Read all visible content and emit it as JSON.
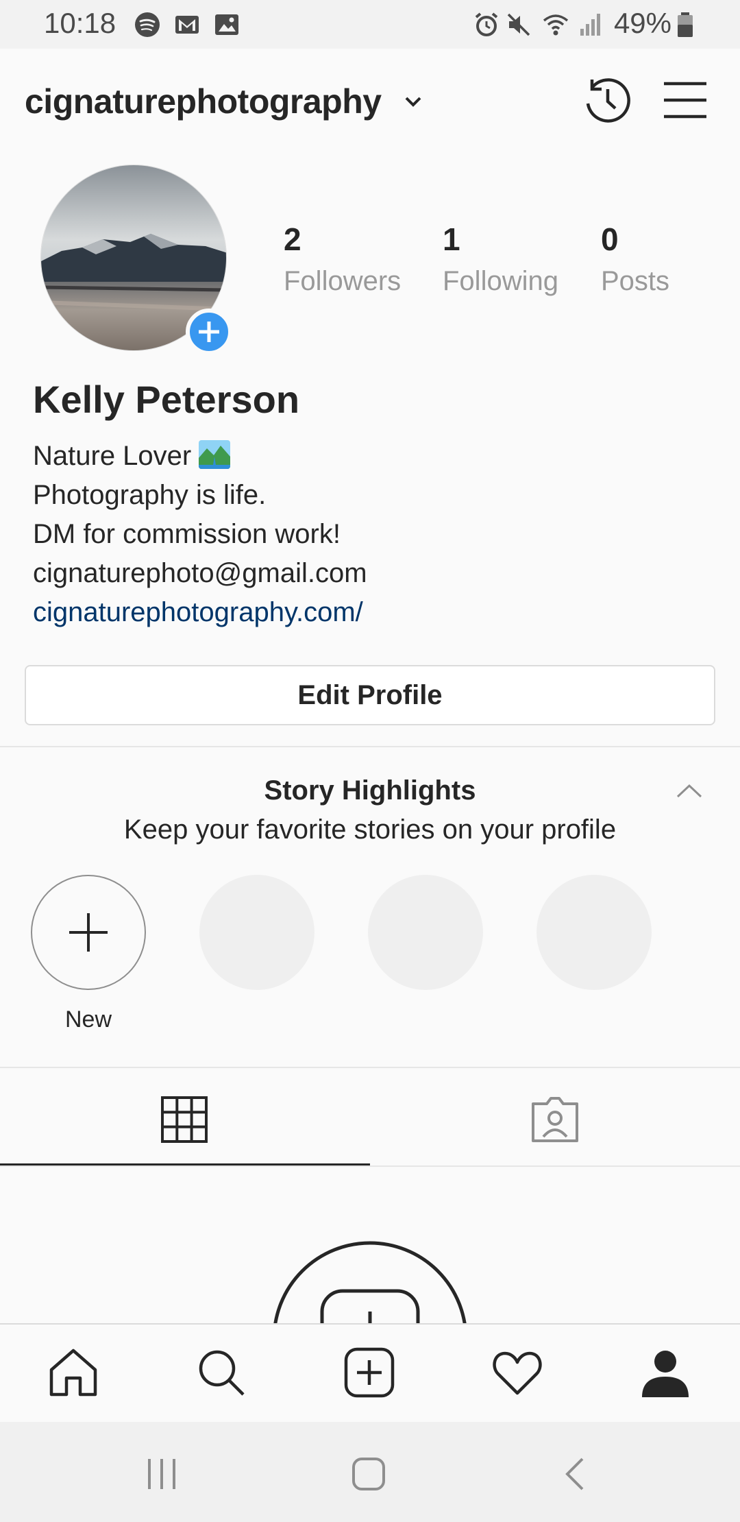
{
  "status_bar": {
    "time": "10:18",
    "battery": "49%"
  },
  "header": {
    "username": "cignaturephotography"
  },
  "profile": {
    "stats": [
      {
        "num": "2",
        "label": "Followers"
      },
      {
        "num": "1",
        "label": "Following"
      },
      {
        "num": "0",
        "label": "Posts"
      }
    ],
    "full_name": "Kelly Peterson",
    "bio_line1": "Nature Lover",
    "bio_line2": "Photography is life.",
    "bio_line3": "DM for commission work!",
    "email": "cignaturephoto@gmail.com",
    "website": "cignaturephotography.com/",
    "edit_button": "Edit Profile"
  },
  "highlights": {
    "title": "Story Highlights",
    "subtitle": "Keep your favorite stories on your profile",
    "new_label": "New"
  },
  "colors": {
    "accent_blue": "#3897f0",
    "link": "#003569",
    "text": "#262626",
    "muted": "#999999"
  }
}
